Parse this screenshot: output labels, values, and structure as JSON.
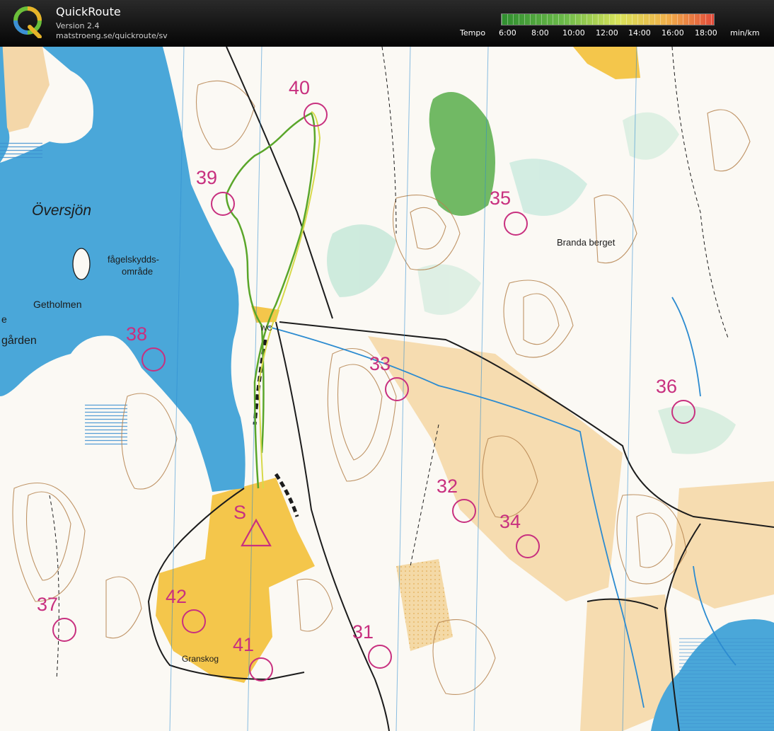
{
  "header": {
    "app_name": "QuickRoute",
    "version": "Version 2.4",
    "url": "matstroeng.se/quickroute/sv",
    "legend": {
      "label": "Tempo",
      "ticks": [
        "6:00",
        "8:00",
        "10:00",
        "12:00",
        "14:00",
        "16:00",
        "18:00"
      ],
      "unit": "min/km"
    },
    "logo_letter": "Q"
  },
  "map": {
    "lake_name": "Översjön",
    "labels": {
      "bird_area_line1": "fågelskydds-",
      "bird_area_line2": "område",
      "island": "Getholmen",
      "farm_letter": "e",
      "farm_partial": "gården",
      "hill": "Branda berget",
      "village": "Granskog",
      "wc": "WC",
      "start": "S"
    },
    "controls": [
      "40",
      "39",
      "35",
      "38",
      "33",
      "36",
      "32",
      "34",
      "42",
      "37",
      "41",
      "31"
    ],
    "colors": {
      "water": "#4aa7d9",
      "open_land": "#f6c84c",
      "rough_open": "#f5dcae",
      "forest_green": "#6db75a",
      "contour": "#b5834e",
      "course_purple": "#c8307f",
      "route_green": "#5aa62a",
      "route_yellow": "#d7d94a"
    }
  }
}
